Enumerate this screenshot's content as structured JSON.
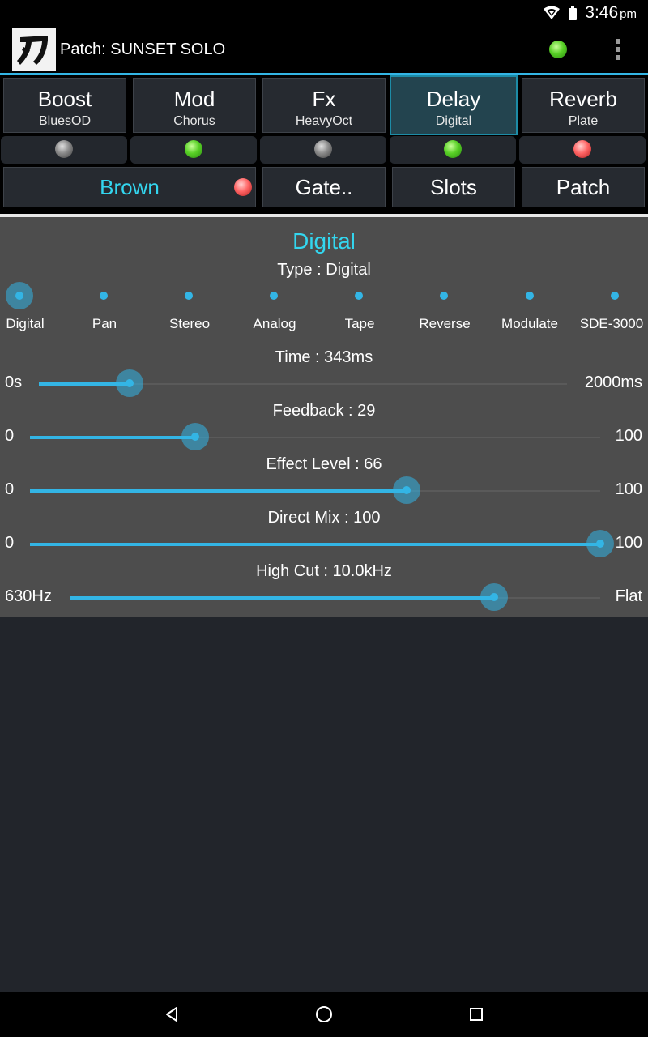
{
  "status_bar": {
    "time": "3:46",
    "ampm": "pm",
    "icons": [
      "wifi-icon",
      "battery-icon"
    ]
  },
  "action_bar": {
    "logo_icon": "katana-logo-icon",
    "patch_label": "Patch: SUNSET SOLO",
    "status_led_color": "#58d026",
    "menu_icon": "overflow-menu-icon"
  },
  "effects": [
    {
      "name": "Boost",
      "sub": "BluesOD",
      "led": "off",
      "active": false
    },
    {
      "name": "Mod",
      "sub": "Chorus",
      "led": "green",
      "active": false
    },
    {
      "name": "Fx",
      "sub": "HeavyOct",
      "led": "off",
      "active": false
    },
    {
      "name": "Delay",
      "sub": "Digital",
      "led": "green",
      "active": true
    },
    {
      "name": "Reverb",
      "sub": "Plate",
      "led": "red",
      "active": false
    }
  ],
  "buttons": {
    "amp": "Brown",
    "amp_led": "red",
    "gate": "Gate..",
    "slots": "Slots",
    "patch": "Patch"
  },
  "panel": {
    "title": "Digital",
    "type_label": "Type : Digital",
    "types": [
      "Digital",
      "Pan",
      "Stereo",
      "Analog",
      "Tape",
      "Reverse",
      "Modulate",
      "SDE-3000"
    ],
    "selected_type_index": 0,
    "sliders": [
      {
        "label": "Time : 343ms",
        "min": "0s",
        "max": "2000ms",
        "fraction": 0.1715
      },
      {
        "label": "Feedback : 29",
        "min": "0",
        "max": "100",
        "fraction": 0.29
      },
      {
        "label": "Effect Level : 66",
        "min": "0",
        "max": "100",
        "fraction": 0.66
      },
      {
        "label": "Direct Mix : 100",
        "min": "0",
        "max": "100",
        "fraction": 1.0
      },
      {
        "label": "High Cut : 10.0kHz",
        "min": "630Hz",
        "max": "Flat",
        "fraction": 0.8
      }
    ]
  },
  "nav_bar": {
    "icons": [
      "back-icon",
      "home-icon",
      "recents-icon"
    ]
  },
  "colors": {
    "accent": "#33b5e5",
    "title_cyan": "#33d6ef",
    "panel_bg": "#4d4d4d"
  }
}
